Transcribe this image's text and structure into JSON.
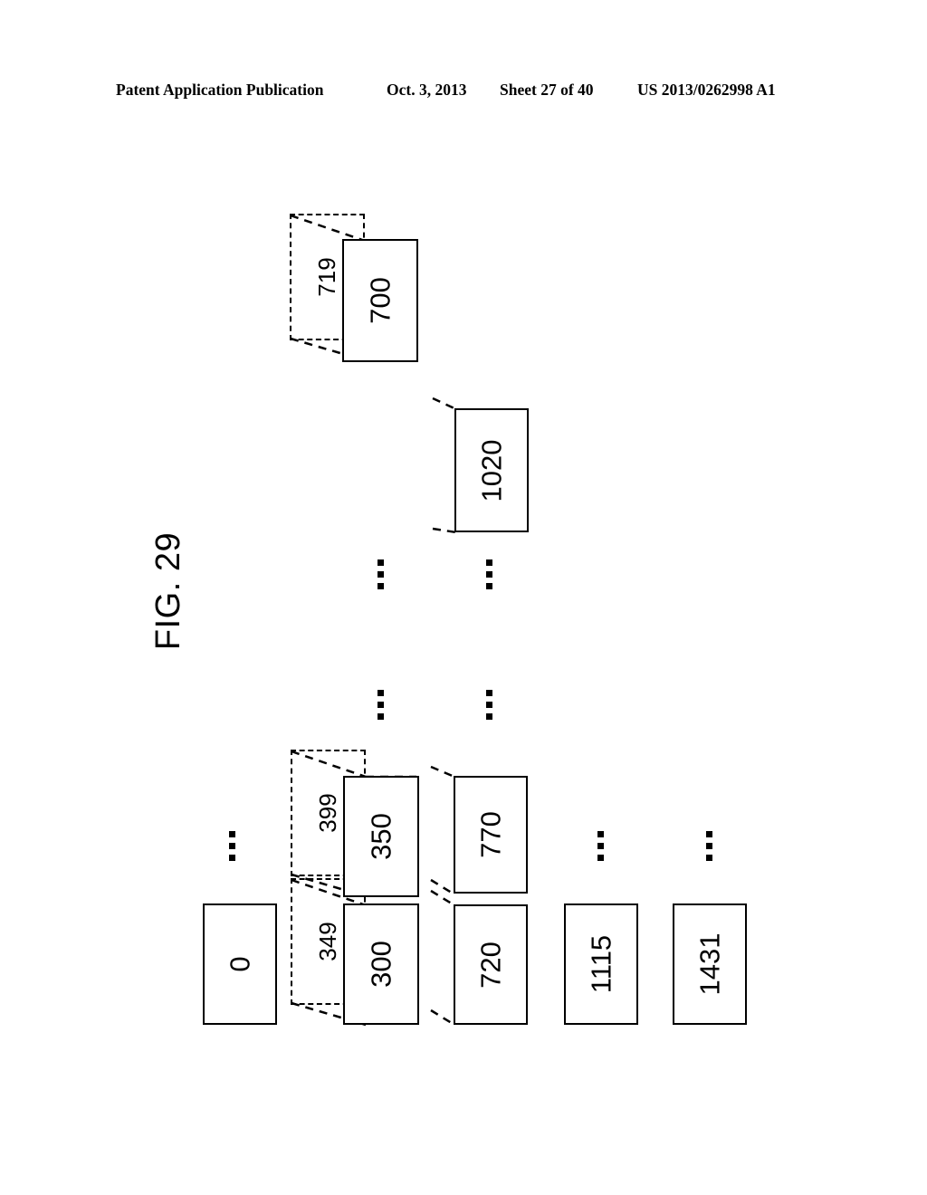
{
  "header": {
    "publication": "Patent Application Publication",
    "date": "Oct. 3, 2013",
    "sheet": "Sheet 27 of 40",
    "patent_number": "US 2013/0262998 A1"
  },
  "figure": {
    "label": "FIG. 29",
    "ink_color": "#000000",
    "background_color": "#ffffff",
    "nodes": [
      {
        "id": "node-700",
        "label": "700",
        "style": "solid"
      },
      {
        "id": "node-1020",
        "label": "1020",
        "style": "solid"
      },
      {
        "id": "node-0",
        "label": "0",
        "style": "solid"
      },
      {
        "id": "node-350",
        "label": "350",
        "style": "solid"
      },
      {
        "id": "node-300",
        "label": "300",
        "style": "solid"
      },
      {
        "id": "node-770",
        "label": "770",
        "style": "solid"
      },
      {
        "id": "node-720",
        "label": "720",
        "style": "solid"
      },
      {
        "id": "node-1115",
        "label": "1115",
        "style": "solid"
      },
      {
        "id": "node-1431",
        "label": "1431",
        "style": "solid"
      }
    ],
    "callouts": [
      {
        "id": "callout-719",
        "label": "719",
        "target": "node-700",
        "style": "dashed"
      },
      {
        "id": "callout-399",
        "label": "399",
        "target": "node-350",
        "style": "dashed"
      },
      {
        "id": "callout-349",
        "label": "349",
        "target": "node-300",
        "style": "dashed"
      }
    ],
    "ellipses": [
      {
        "id": "ellipsis-col-350-upper"
      },
      {
        "id": "ellipsis-col-770-upper"
      },
      {
        "id": "ellipsis-col-350-lower"
      },
      {
        "id": "ellipsis-col-770-lower"
      },
      {
        "id": "ellipsis-col-0"
      },
      {
        "id": "ellipsis-col-1115"
      },
      {
        "id": "ellipsis-col-1431"
      }
    ]
  }
}
